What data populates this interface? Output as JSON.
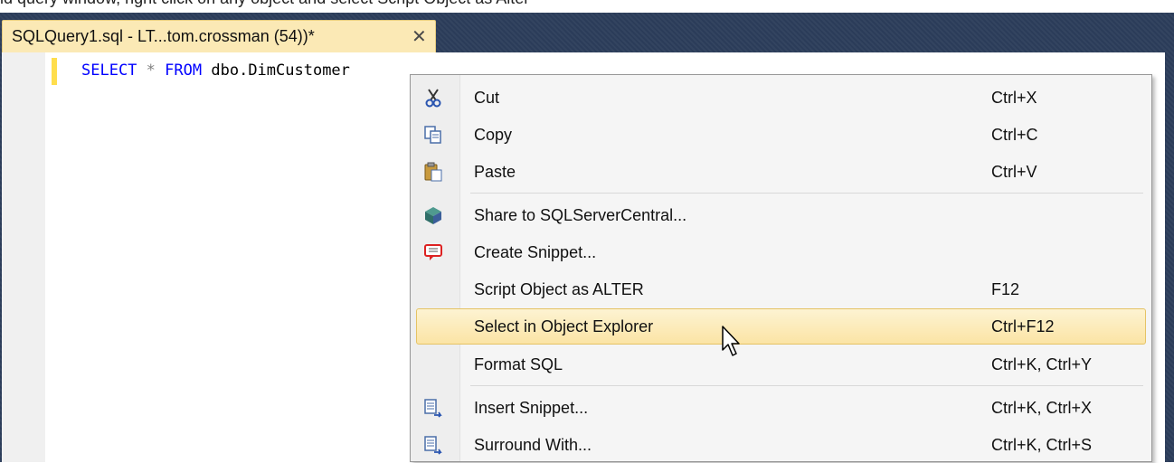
{
  "top_caption": "ld query window, right click on any object and select Script Object as Alter",
  "tab": {
    "title": "SQLQuery1.sql - LT...tom.crossman (54))*",
    "close_glyph": "✕"
  },
  "editor": {
    "line1": {
      "kw_select": "SELECT",
      "star": "*",
      "kw_from": "FROM",
      "object": "dbo.DimCustomer"
    }
  },
  "context_menu": {
    "items": [
      {
        "label": "Cut",
        "shortcut": "Ctrl+X",
        "icon": "scissors-icon"
      },
      {
        "label": "Copy",
        "shortcut": "Ctrl+C",
        "icon": "copy-icon"
      },
      {
        "label": "Paste",
        "shortcut": "Ctrl+V",
        "icon": "paste-icon"
      },
      {
        "label": "Share to SQLServerCentral...",
        "shortcut": "",
        "icon": "share-cube-icon"
      },
      {
        "label": "Create Snippet...",
        "shortcut": "",
        "icon": "speech-bubble-icon"
      },
      {
        "label": "Script Object as ALTER",
        "shortcut": "F12",
        "icon": ""
      },
      {
        "label": "Select in Object Explorer",
        "shortcut": "Ctrl+F12",
        "icon": "",
        "highlighted": true
      },
      {
        "label": "Format SQL",
        "shortcut": "Ctrl+K, Ctrl+Y",
        "icon": ""
      },
      {
        "label": "Insert Snippet...",
        "shortcut": "Ctrl+K, Ctrl+X",
        "icon": "snippet-insert-icon"
      },
      {
        "label": "Surround With...",
        "shortcut": "Ctrl+K, Ctrl+S",
        "icon": "snippet-insert-icon"
      }
    ]
  },
  "colors": {
    "frame": "#2b3c59",
    "tab_active": "#fbe9b5",
    "menu_highlight": "#fbe4a5",
    "keyword": "#0000ff"
  }
}
